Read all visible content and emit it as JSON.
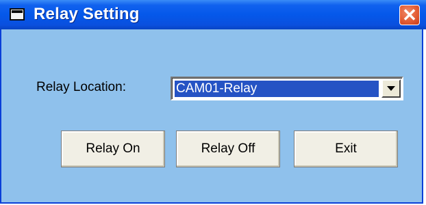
{
  "window": {
    "title": "Relay Setting",
    "close_symbol": "✕"
  },
  "form": {
    "relay_location_label": "Relay Location:",
    "relay_location_value": "CAM01-Relay"
  },
  "buttons": {
    "relay_on": "Relay On",
    "relay_off": "Relay Off",
    "exit": "Exit"
  },
  "icons": {
    "window_icon": "window-icon",
    "close_icon": "close-icon",
    "dropdown_icon": "chevron-down-icon"
  },
  "colors": {
    "titlebar": "#0558ea",
    "window_bg": "#8fc1ec",
    "selection": "#2553c4",
    "close_button": "#e35d35"
  }
}
